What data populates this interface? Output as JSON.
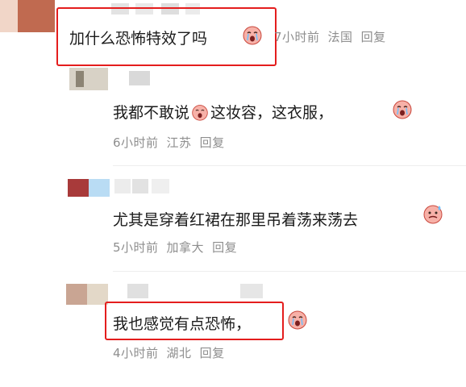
{
  "comments": [
    {
      "text": "加什么恐怖特效了吗",
      "time": "7小时前",
      "location": "法国",
      "reply": "回复",
      "emoji": "crying-face-icon"
    },
    {
      "text_part1": "我都不敢说",
      "text_part2": "这妆容，这衣服，",
      "time": "6小时前",
      "location": "江苏",
      "reply": "回复",
      "emoji": "crying-face-icon"
    },
    {
      "text": "尤其是穿着红裙在那里吊着荡来荡去",
      "time": "5小时前",
      "location": "加拿大",
      "reply": "回复",
      "emoji": "sweating-face-icon"
    },
    {
      "text": "我也感觉有点恐怖，",
      "time": "4小时前",
      "location": "湖北",
      "reply": "回复",
      "emoji": "crying-face-icon"
    }
  ],
  "colors": {
    "highlight_box": "#e41d1d",
    "meta_text": "#8e8e8e",
    "body_text": "#1b1b1b"
  }
}
